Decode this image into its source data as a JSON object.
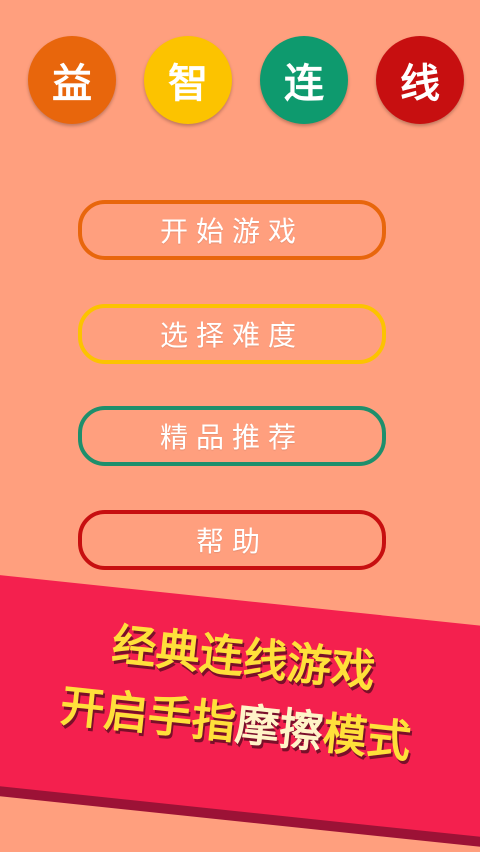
{
  "title_chars": [
    "益",
    "智",
    "连",
    "线"
  ],
  "title_colors": [
    "#e8660c",
    "#fcc300",
    "#0e9a6e",
    "#c70f10"
  ],
  "menu": {
    "start": "开始游戏",
    "difficulty": "选择难度",
    "recommend": "精品推荐",
    "help": "帮助"
  },
  "banner": {
    "line1": "经典连线游戏",
    "line2_a": "开启手指",
    "line2_b": "摩擦",
    "line2_c": "模式"
  },
  "colors": {
    "background": "#ff9f7e",
    "banner": "#f4204e",
    "banner_text": "#ffe03a"
  }
}
